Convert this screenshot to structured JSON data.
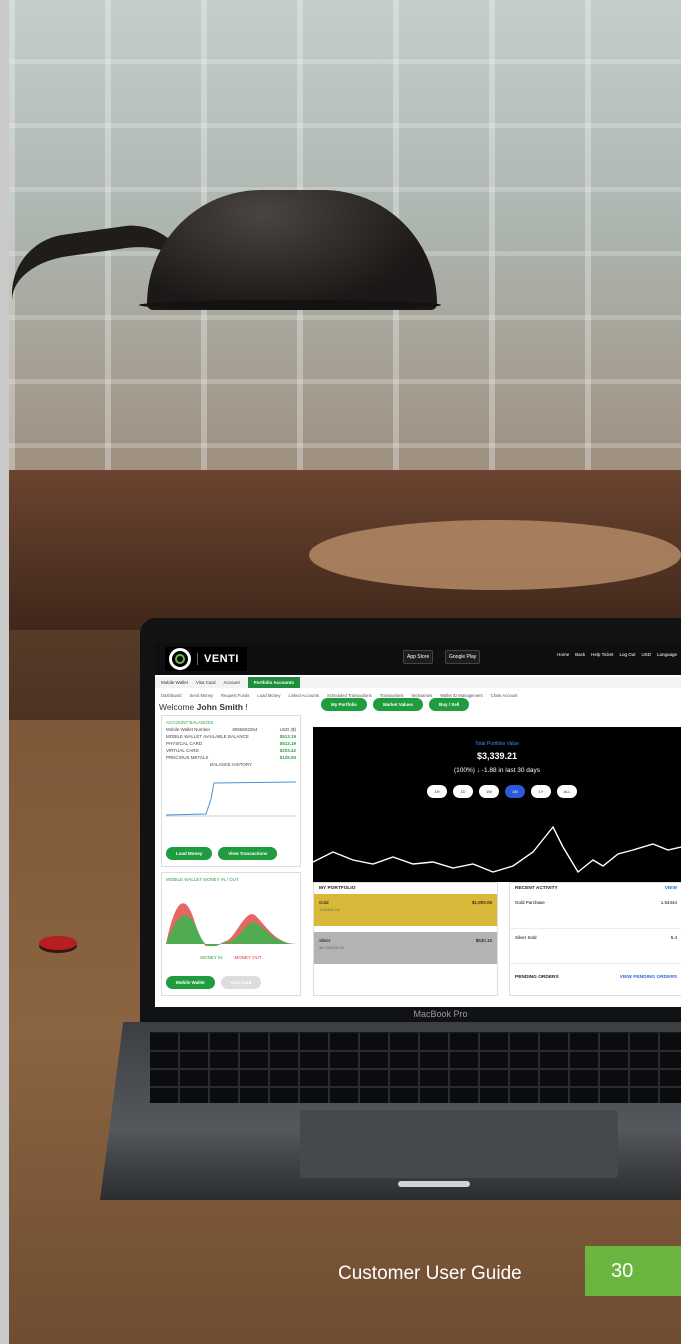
{
  "app": {
    "brand": "VENTI"
  },
  "topbar": {
    "app_store": "App Store",
    "google_play": "Google Play",
    "nav": [
      "Home",
      "Back",
      "Help Ticket",
      "Log Out",
      "USD",
      "Language"
    ]
  },
  "main_nav": [
    "Mobile Wallet",
    "Visa Card",
    "Account",
    "Portfolio Accounts"
  ],
  "sub_nav": [
    "Dashboard",
    "Send Money",
    "Request Funds",
    "Load Money",
    "Linked Accounts",
    "Scheduled Transactions",
    "Transactions",
    "Nicknames",
    "Wallet ID Management",
    "Close Account"
  ],
  "welcome": {
    "prefix": "Welcome",
    "name": "John Smith",
    "suffix": "!"
  },
  "portfolio_tabs": [
    "My Portfolio",
    "Market Values",
    "Buy / Sell"
  ],
  "balances": {
    "title": "ACCOUNT BALANCES",
    "rows": [
      {
        "label": "Mobile Wallet Number",
        "value": "8056602254",
        "extra": "USD ($)"
      },
      {
        "label": "MOBILE WALLET AVAILABLE BALANCE",
        "value": "$513.19"
      },
      {
        "label": "PHYSICAL CARD",
        "value": "$513.19"
      },
      {
        "label": "VIRTUAL CARD",
        "value": "$203.42"
      },
      {
        "label": "PRECIOUS METALS",
        "value": "$125.00"
      }
    ],
    "history_title": "BALANCE HISTORY",
    "load_money": "Load Money",
    "view_transactions": "View Transactions"
  },
  "money_io": {
    "title": "MOBILE WALLET MONEY IN / OUT",
    "legend_in": "MONEY IN",
    "legend_out": "MONEY OUT",
    "mobile_wallet": "Mobile Wallet",
    "visa_card": "Visa Card"
  },
  "portfolio_value": {
    "title": "Total Portfolio Value",
    "value": "$3,339.21",
    "change": "(100%) ↓ -1.88 in last 30 days",
    "ranges": [
      "1H",
      "1D",
      "1W",
      "1M",
      "1Y",
      "ALL"
    ],
    "active_range": "1M"
  },
  "my_portfolio": {
    "title": "MY PORTFOLIO",
    "items": [
      {
        "name": "Gold",
        "sub": "1.54444 Oz",
        "value": "$1,809.06"
      },
      {
        "name": "Silver",
        "sub": "36.795325 Oz",
        "value": "$530.15"
      }
    ]
  },
  "recent_activity": {
    "title": "RECENT ACTIVITY",
    "view": "VIEW",
    "items": [
      {
        "name": "Gold Purchase",
        "value": "1.54444"
      },
      {
        "name": "Silver Sold",
        "value": "5.4"
      }
    ],
    "pending": "PENDING ORDERS",
    "view_pending": "VIEW PENDING ORDERS"
  },
  "laptop_brand": "MacBook Pro",
  "footer": {
    "label": "Customer User Guide",
    "page": "30"
  },
  "colors": {
    "green": "#1e9c3e",
    "badge": "#6ab640",
    "gold": "#d8b93a",
    "silver": "#b3b3b3"
  }
}
